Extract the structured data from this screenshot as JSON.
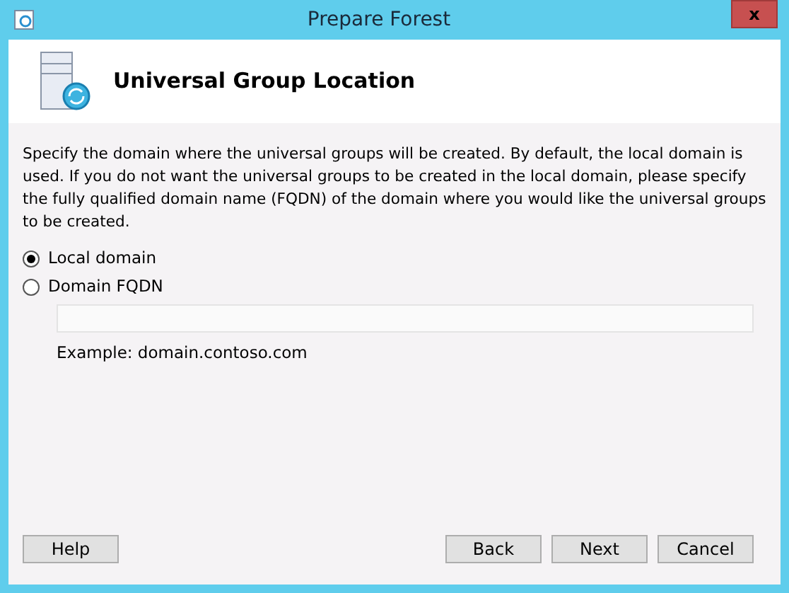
{
  "window": {
    "title": "Prepare Forest",
    "close": "x"
  },
  "header": {
    "title": "Universal Group Location"
  },
  "description": "Specify the domain where the universal groups will be created. By default, the local domain is used. If you do not want the universal groups to be created in the local domain, please specify the fully qualified domain name (FQDN) of the domain where you would like the universal groups to be created.",
  "options": [
    {
      "label": "Local domain",
      "selected": true
    },
    {
      "label": "Domain FQDN",
      "selected": false
    }
  ],
  "fqdn_field": {
    "disabled": true
  },
  "example": "Example: domain.contoso.com",
  "help_button": "Help",
  "nav_buttons": [
    "Back",
    "Next",
    "Cancel"
  ]
}
